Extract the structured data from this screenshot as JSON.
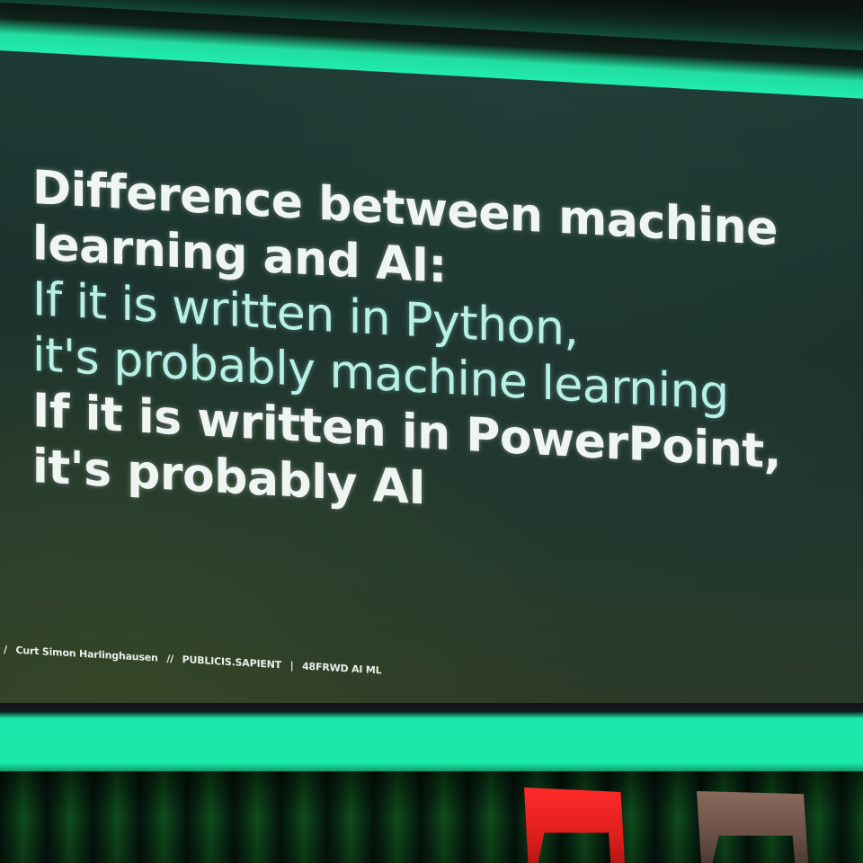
{
  "slide": {
    "heading_line1": "Difference between machine",
    "heading_line2": "learning and AI:",
    "python_line1": "If it is written in Python,",
    "python_line2": "it's probably machine learning",
    "powerpoint_line1": "If it is written in PowerPoint,",
    "powerpoint_line2": "it's probably AI"
  },
  "credit": {
    "lead_mark": "/",
    "speaker": "Curt Simon Harlinghausen",
    "separator1": "//",
    "company": "PUBLICIS.SAPIENT",
    "separator2": "|",
    "event": "48FRWD AI ML"
  },
  "colors": {
    "led_frame": "#1ff0b0",
    "slide_background": "#1e3a34",
    "heading_text": "#eef5f2",
    "python_text": "#b8f0e6",
    "chair_red": "#e0201c",
    "chair_brown": "#6b5146",
    "curtain": "#0a3418"
  }
}
